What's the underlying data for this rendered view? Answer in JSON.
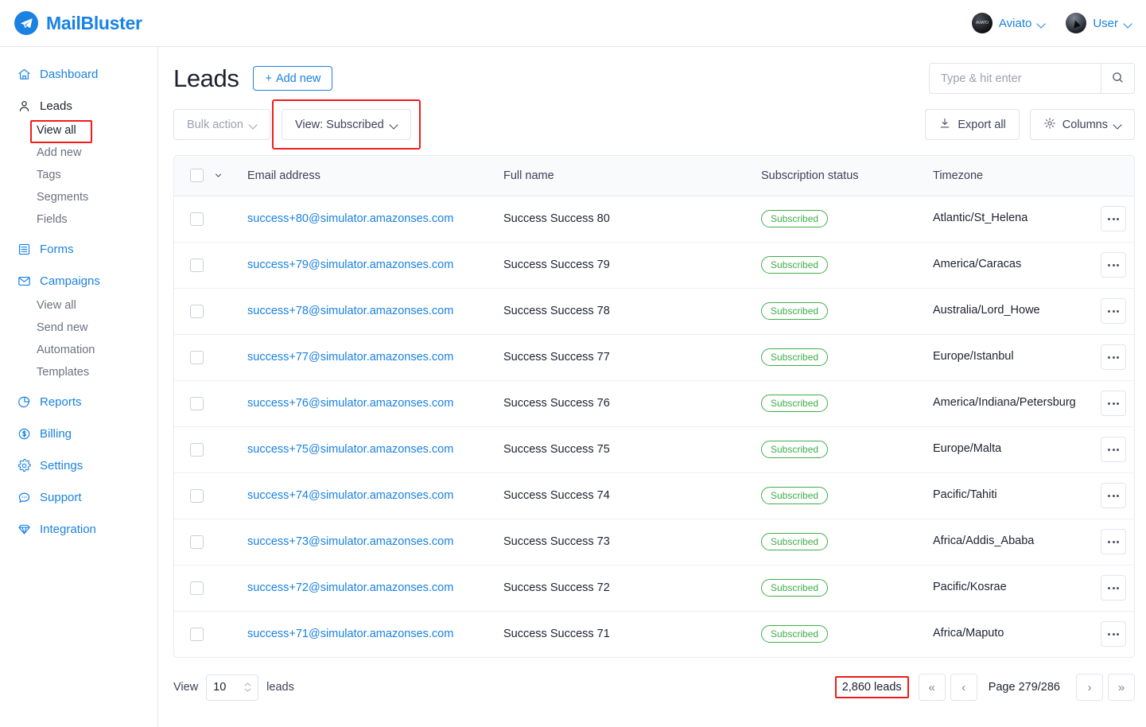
{
  "app": {
    "brand_name": "MailBluster",
    "brand_icon": "paper-plane-icon",
    "accent_color": "#1a82e2",
    "highlight_color": "#f01c1c",
    "badge_color": "#3fae49"
  },
  "topbar": {
    "workspace": {
      "label": "Aviato",
      "icon": "workspace-avatar"
    },
    "user": {
      "label": "User",
      "icon": "user-avatar"
    }
  },
  "sidebar": {
    "items": [
      {
        "label": "Dashboard",
        "icon": "home-icon",
        "type": "link",
        "state": "default"
      },
      {
        "label": "Leads",
        "icon": "person-icon",
        "type": "section",
        "state": "active"
      },
      {
        "label": "View all",
        "icon": "",
        "type": "sub",
        "state": "selected-highlighted"
      },
      {
        "label": "Add new",
        "icon": "",
        "type": "sub",
        "state": "default"
      },
      {
        "label": "Tags",
        "icon": "",
        "type": "sub",
        "state": "default"
      },
      {
        "label": "Segments",
        "icon": "",
        "type": "sub",
        "state": "default"
      },
      {
        "label": "Fields",
        "icon": "",
        "type": "sub",
        "state": "default"
      },
      {
        "label": "Forms",
        "icon": "form-icon",
        "type": "link",
        "state": "default"
      },
      {
        "label": "Campaigns",
        "icon": "envelope-icon",
        "type": "section",
        "state": "default"
      },
      {
        "label": "View all",
        "icon": "",
        "type": "sub",
        "state": "default"
      },
      {
        "label": "Send new",
        "icon": "",
        "type": "sub",
        "state": "default"
      },
      {
        "label": "Automation",
        "icon": "",
        "type": "sub",
        "state": "default"
      },
      {
        "label": "Templates",
        "icon": "",
        "type": "sub",
        "state": "default"
      },
      {
        "label": "Reports",
        "icon": "pie-chart-icon",
        "type": "link",
        "state": "default"
      },
      {
        "label": "Billing",
        "icon": "dollar-circle-icon",
        "type": "link",
        "state": "default"
      },
      {
        "label": "Settings",
        "icon": "gear-icon",
        "type": "link",
        "state": "default"
      },
      {
        "label": "Support",
        "icon": "chat-bubble-icon",
        "type": "link",
        "state": "default"
      },
      {
        "label": "Integration",
        "icon": "diamond-icon",
        "type": "link",
        "state": "default"
      }
    ]
  },
  "page": {
    "title": "Leads",
    "add_new_label": "Add new"
  },
  "search": {
    "placeholder": "Type & hit enter",
    "value": "",
    "icon": "search-icon"
  },
  "toolbar": {
    "bulk_action_label": "Bulk action",
    "view_label": "View: Subscribed",
    "export_label": "Export all",
    "export_icon": "download-icon",
    "columns_label": "Columns",
    "columns_icon": "gear-icon"
  },
  "table": {
    "columns": [
      "Email address",
      "Full name",
      "Subscription status",
      "Timezone"
    ],
    "rows": [
      {
        "email": "success+80@simulator.amazonses.com",
        "name": "Success Success 80",
        "status": "Subscribed",
        "timezone": "Atlantic/St_Helena"
      },
      {
        "email": "success+79@simulator.amazonses.com",
        "name": "Success Success 79",
        "status": "Subscribed",
        "timezone": "America/Caracas"
      },
      {
        "email": "success+78@simulator.amazonses.com",
        "name": "Success Success 78",
        "status": "Subscribed",
        "timezone": "Australia/Lord_Howe"
      },
      {
        "email": "success+77@simulator.amazonses.com",
        "name": "Success Success 77",
        "status": "Subscribed",
        "timezone": "Europe/Istanbul"
      },
      {
        "email": "success+76@simulator.amazonses.com",
        "name": "Success Success 76",
        "status": "Subscribed",
        "timezone": "America/Indiana/Petersburg"
      },
      {
        "email": "success+75@simulator.amazonses.com",
        "name": "Success Success 75",
        "status": "Subscribed",
        "timezone": "Europe/Malta"
      },
      {
        "email": "success+74@simulator.amazonses.com",
        "name": "Success Success 74",
        "status": "Subscribed",
        "timezone": "Pacific/Tahiti"
      },
      {
        "email": "success+73@simulator.amazonses.com",
        "name": "Success Success 73",
        "status": "Subscribed",
        "timezone": "Africa/Addis_Ababa"
      },
      {
        "email": "success+72@simulator.amazonses.com",
        "name": "Success Success 72",
        "status": "Subscribed",
        "timezone": "Pacific/Kosrae"
      },
      {
        "email": "success+71@simulator.amazonses.com",
        "name": "Success Success 71",
        "status": "Subscribed",
        "timezone": "Africa/Maputo"
      }
    ]
  },
  "footer": {
    "view_label": "View",
    "page_size": "10",
    "leads_label": "leads",
    "total_leads": "2,860 leads",
    "page_label": "Page 279/286",
    "first_icon": "«",
    "prev_icon": "‹",
    "next_icon": "›",
    "last_icon": "»"
  }
}
